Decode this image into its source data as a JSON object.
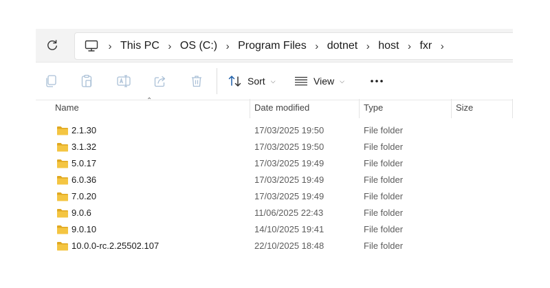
{
  "address_bar": {
    "breadcrumbs": [
      "This PC",
      "OS (C:)",
      "Program Files",
      "dotnet",
      "host",
      "fxr"
    ],
    "refresh_icon": "refresh-icon",
    "root_icon": "computer-icon"
  },
  "command_bar": {
    "tools": [
      "copy-icon",
      "paste-icon",
      "rename-icon",
      "share-icon",
      "delete-icon"
    ],
    "sort_label": "Sort",
    "view_label": "View",
    "more_label": "•••"
  },
  "columns": {
    "name": "Name",
    "date_modified": "Date modified",
    "type": "Type",
    "size": "Size"
  },
  "files": [
    {
      "name": "2.1.30",
      "date": "17/03/2025 19:50",
      "type": "File folder",
      "size": ""
    },
    {
      "name": "3.1.32",
      "date": "17/03/2025 19:50",
      "type": "File folder",
      "size": ""
    },
    {
      "name": "5.0.17",
      "date": "17/03/2025 19:49",
      "type": "File folder",
      "size": ""
    },
    {
      "name": "6.0.36",
      "date": "17/03/2025 19:49",
      "type": "File folder",
      "size": ""
    },
    {
      "name": "7.0.20",
      "date": "17/03/2025 19:49",
      "type": "File folder",
      "size": ""
    },
    {
      "name": "9.0.6",
      "date": "11/06/2025 22:43",
      "type": "File folder",
      "size": ""
    },
    {
      "name": "9.0.10",
      "date": "14/10/2025 19:41",
      "type": "File folder",
      "size": ""
    },
    {
      "name": "10.0.0-rc.2.25502.107",
      "date": "22/10/2025 18:48",
      "type": "File folder",
      "size": ""
    }
  ],
  "colors": {
    "folder": "#f4c542",
    "folder_dark": "#e0a820",
    "disabled_icon": "#a9bfd6"
  }
}
